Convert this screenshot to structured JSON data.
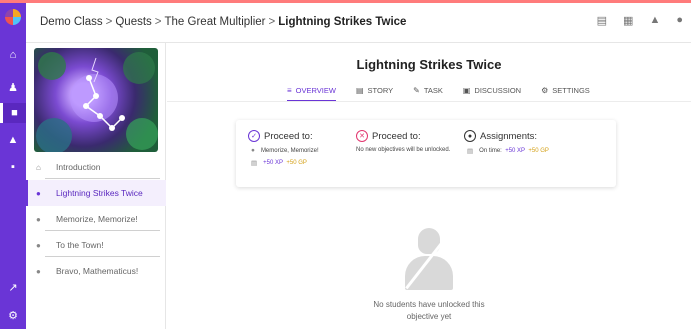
{
  "breadcrumb": {
    "items": [
      "Demo Class",
      "Quests",
      "The Great Multiplier"
    ],
    "separator": ">",
    "current": "Lightning Strikes Twice"
  },
  "rail": {
    "icons": [
      "app-logo",
      "home-icon",
      "users-icon",
      "quests-icon",
      "assignments-icon",
      "chat-icon",
      "analytics-icon",
      "settings-icon"
    ]
  },
  "quest_list": [
    {
      "label": "Introduction",
      "icon": "home-icon",
      "active": false
    },
    {
      "label": "Lightning Strikes Twice",
      "icon": "pin-icon",
      "active": true
    },
    {
      "label": "Memorize, Memorize!",
      "icon": "pin-icon",
      "active": false
    },
    {
      "label": "To the Town!",
      "icon": "pin-icon",
      "active": false
    },
    {
      "label": "Bravo, Mathematicus!",
      "icon": "trophy-pin-icon",
      "active": false
    }
  ],
  "main": {
    "title": "Lightning Strikes Twice",
    "tabs": [
      {
        "label": "OVERVIEW",
        "icon": "overview-icon",
        "active": true
      },
      {
        "label": "STORY",
        "icon": "book-icon",
        "active": false
      },
      {
        "label": "TASK",
        "icon": "edit-icon",
        "active": false
      },
      {
        "label": "DISCUSSION",
        "icon": "discussion-icon",
        "active": false
      },
      {
        "label": "SETTINGS",
        "icon": "gear-icon",
        "active": false
      }
    ]
  },
  "overview": {
    "proceed_success": {
      "heading": "Proceed to:",
      "target": "Memorize, Memorize!",
      "xp": "+50 XP",
      "gp": "+50 GP"
    },
    "proceed_fail": {
      "heading": "Proceed to:",
      "text": "No new objectives will be unlocked."
    },
    "assignments": {
      "heading": "Assignments:",
      "on_time_label": "On time:",
      "xp": "+50 XP",
      "gp": "+50 GP"
    }
  },
  "empty_state": {
    "line1": "No students have unlocked this",
    "line2": "objective yet"
  },
  "colors": {
    "rail": "#6a35d6",
    "accent": "#6a35d6",
    "xp": "#6a35d6",
    "gp": "#d4a017",
    "fail": "#e2366f"
  }
}
